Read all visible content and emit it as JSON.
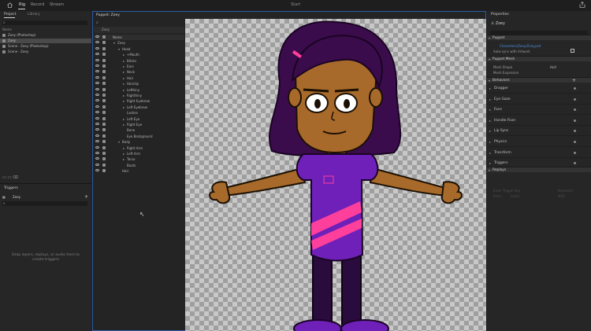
{
  "app": {
    "title": "Start",
    "tabs": [
      "Rig",
      "Record",
      "Stream"
    ],
    "active_tab": "Rig"
  },
  "project_panel": {
    "tabs": [
      "Project",
      "Library"
    ],
    "column_header": "Name",
    "items": [
      "Zoey (Photoshop)",
      "Zoey",
      "Scene - Zoey (Photoshop)",
      "Scene - Zoey"
    ],
    "selected_index": 1
  },
  "triggers_panel": {
    "title": "Triggers",
    "puppet": "Zoey",
    "empty_hint_line1": "Drop layers, replays, or audio here to",
    "empty_hint_line2": "create triggers"
  },
  "puppet_panel": {
    "title": "Puppet: Zoey",
    "toolbar_label": "Zoey",
    "tree": [
      {
        "label": "Name",
        "indent": 0,
        "arrow": ""
      },
      {
        "label": "Zoey",
        "indent": 1,
        "arrow": "▾"
      },
      {
        "label": "Head",
        "indent": 2,
        "arrow": "▾"
      },
      {
        "label": "+Mouth",
        "indent": 3,
        "arrow": "▸"
      },
      {
        "label": "Blinks",
        "indent": 3,
        "arrow": "▸"
      },
      {
        "label": "Ears",
        "indent": 3,
        "arrow": "▸"
      },
      {
        "label": "Neck",
        "indent": 3,
        "arrow": "▸"
      },
      {
        "label": "Hair",
        "indent": 3,
        "arrow": "▸"
      },
      {
        "label": "Hairclip",
        "indent": 3,
        "arrow": "▸"
      },
      {
        "label": "Lefthiny",
        "indent": 3,
        "arrow": "▸"
      },
      {
        "label": "Righthiny",
        "indent": 3,
        "arrow": "▸"
      },
      {
        "label": "Right Eyebrow",
        "indent": 3,
        "arrow": "▸"
      },
      {
        "label": "Left Eyebrow",
        "indent": 3,
        "arrow": "▸"
      },
      {
        "label": "Lashes",
        "indent": 3,
        "arrow": ""
      },
      {
        "label": "Left Eye",
        "indent": 3,
        "arrow": "▸"
      },
      {
        "label": "Right Eye",
        "indent": 3,
        "arrow": "▸"
      },
      {
        "label": "Bone",
        "indent": 3,
        "arrow": ""
      },
      {
        "label": "Eye Background",
        "indent": 3,
        "arrow": ""
      },
      {
        "label": "Body",
        "indent": 2,
        "arrow": "▾"
      },
      {
        "label": "Right Arm",
        "indent": 3,
        "arrow": "▸"
      },
      {
        "label": "Left Arm",
        "indent": 3,
        "arrow": "▸"
      },
      {
        "label": "Torso",
        "indent": 3,
        "arrow": "▸"
      },
      {
        "label": "Boots",
        "indent": 3,
        "arrow": ""
      },
      {
        "label": "Hair",
        "indent": 2,
        "arrow": ""
      }
    ]
  },
  "properties_panel": {
    "title": "Properties",
    "object_name": "Zoey",
    "sections": {
      "puppet": "Puppet",
      "source_link": "Characters/Zoey/Zoey.psd",
      "auto_sync": "Auto-sync with Artwork",
      "puppet_mesh": "Puppet Mesh",
      "mesh_shape": "Mesh Shape",
      "mesh_shape_value": "Hull",
      "mesh_expansion": "Mesh Expansion",
      "behaviors": "Behaviors",
      "replays": "Replays"
    },
    "behaviors": [
      "Dragger",
      "Eye Gaze",
      "Face",
      "Handle Fixer",
      "Lip Sync",
      "Physics",
      "Transform",
      "Triggers"
    ],
    "replays_dim": [
      "Enter Trigger Key",
      "Press",
      "Latch",
      "Keyboard",
      "MIDI"
    ]
  },
  "colors": {
    "accent_blue": "#2b5fa8",
    "skin": "#a86a2a",
    "hair": "#3b0c4b",
    "shirt": "#6e20b8",
    "pants": "#2a0b3d",
    "stripe": "#ff3f9c"
  },
  "icons": [
    "home-icon",
    "share-icon",
    "search-icon",
    "eye-icon",
    "lock-icon",
    "folder-icon",
    "trash-icon",
    "add-icon"
  ]
}
